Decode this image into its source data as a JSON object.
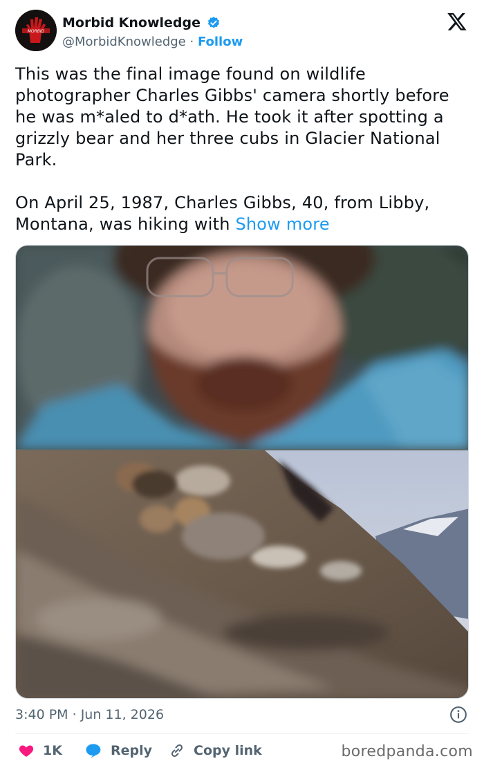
{
  "author": {
    "display_name": "Morbid Knowledge",
    "handle": "@MorbidKnowledge",
    "separator": "·",
    "follow_label": "Follow",
    "avatar_icon": "red-handprint-logo-icon",
    "verified_icon": "verified-badge-icon"
  },
  "brand": {
    "icon": "x-logo-icon"
  },
  "tweet": {
    "paragraph1": "This was the final image found on wildlife photographer Charles Gibbs' camera shortly before he was m*aled to d*ath. He took it after spotting a grizzly bear and her three cubs in Glacier National Park.",
    "paragraph2": "On April 25, 1987, Charles Gibbs, 40, from Libby, Montana, was hiking with",
    "show_more_label": "Show more"
  },
  "media": {
    "top_image": "bearded-man-with-glasses-photo",
    "bottom_image": "grizzly-bear-and-cubs-on-hillside-photo"
  },
  "meta": {
    "time": "3:40 PM",
    "separator": "·",
    "date": "Jun 11, 2026",
    "info_icon": "info-icon"
  },
  "actions": {
    "like_count": "1K",
    "reply_label": "Reply",
    "copy_label": "Copy link"
  },
  "watermark": "boredpanda.com",
  "colors": {
    "accent": "#1d9bf0",
    "like": "#f91880",
    "text": "#0f1419",
    "secondary": "#536471"
  }
}
